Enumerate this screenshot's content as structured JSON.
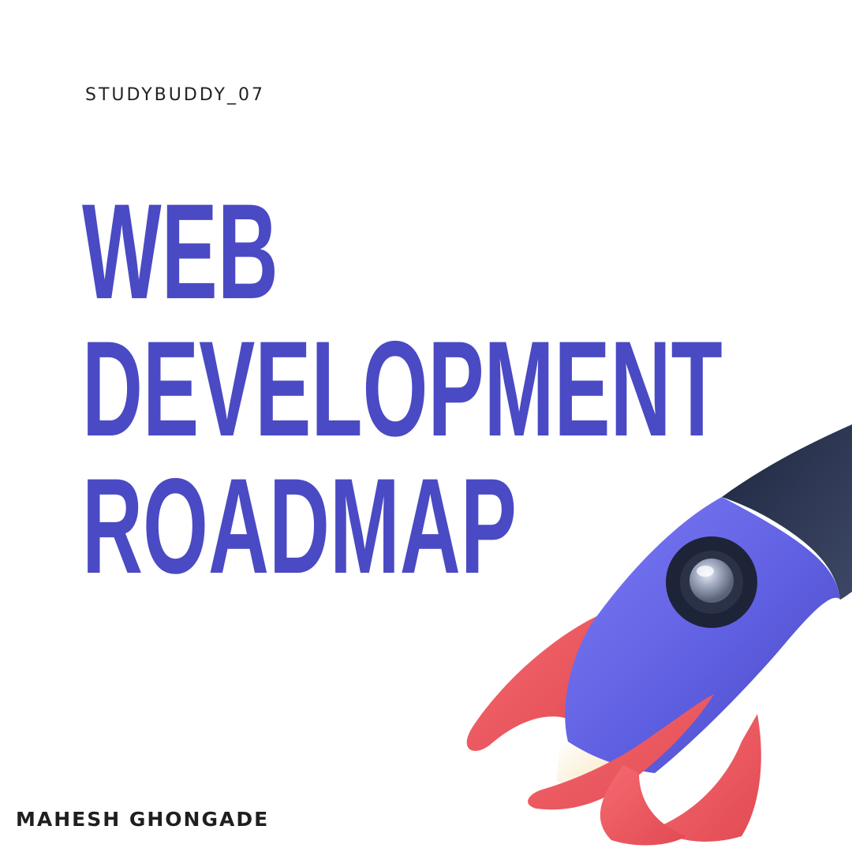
{
  "header": {
    "handle": "STUDYBUDDY_07"
  },
  "title": {
    "lines": [
      "WEB",
      "DEVELOPMENT",
      "ROADMAP"
    ]
  },
  "footer": {
    "author": "MAHESH GHONGADE"
  },
  "illustration": {
    "icon": "rocket-icon"
  },
  "colors": {
    "background": "#ffffff",
    "title": "#4a4ac4",
    "rocket_body": "#6363e6",
    "rocket_nose": "#2a3350",
    "rocket_fins": "#f05860",
    "text_dark": "#222222"
  }
}
